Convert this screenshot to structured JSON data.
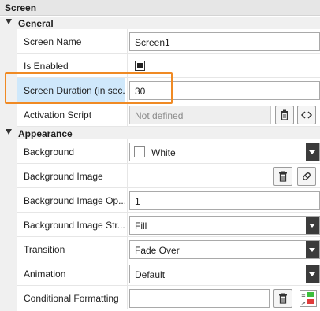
{
  "panel": {
    "title": "Screen"
  },
  "sections": {
    "general": {
      "title": "General"
    },
    "appearance": {
      "title": "Appearance"
    }
  },
  "general": {
    "screen_name": {
      "label": "Screen Name",
      "value": "Screen1"
    },
    "is_enabled": {
      "label": "Is Enabled",
      "checked": true
    },
    "screen_duration": {
      "label": "Screen Duration (in sec...",
      "value": "30"
    },
    "activation_script": {
      "label": "Activation Script",
      "value": "Not defined"
    }
  },
  "appearance": {
    "background": {
      "label": "Background",
      "value": "White",
      "swatch_color": "#ffffff"
    },
    "background_image": {
      "label": "Background Image"
    },
    "background_image_opacity": {
      "label": "Background Image Op...",
      "value": "1"
    },
    "background_image_stretch": {
      "label": "Background Image Str...",
      "value": "Fill"
    },
    "transition": {
      "label": "Transition",
      "value": "Fade Over"
    },
    "animation": {
      "label": "Animation",
      "value": "Default"
    },
    "conditional_formatting": {
      "label": "Conditional Formatting",
      "value": ""
    }
  },
  "colors": {
    "highlight_border": "#f08a24",
    "highlight_fill": "#cfe8fb",
    "dropdown_arrow_bg": "#3b3b3b",
    "cf_green": "#3cbf3c",
    "cf_red": "#e03c3c"
  }
}
